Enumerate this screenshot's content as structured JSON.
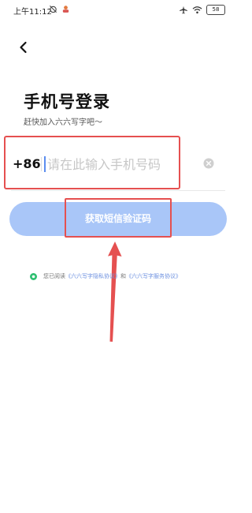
{
  "status_bar": {
    "time": "上午11:12",
    "battery": "58",
    "icons": [
      "alarm-off-icon",
      "app-notification-icon",
      "airplane-icon",
      "wifi-icon",
      "battery-icon"
    ]
  },
  "header": {
    "back_icon": "chevron-left-icon"
  },
  "login": {
    "title": "手机号登录",
    "subtitle": "赶快加入六六写字吧～",
    "country_code": "+86",
    "phone_placeholder": "请在此输入手机号码",
    "phone_value": "",
    "clear_icon": "clear-circle-icon",
    "get_code_label": "获取短信验证码"
  },
  "agreement": {
    "prefix": "您已阅读",
    "privacy_link": "《六六写字隐私协议》",
    "connector": "和",
    "service_link": "《六六写字服务协议》"
  },
  "colors": {
    "button_bg": "#a9c6f8",
    "annotation_red": "#e55050",
    "link_blue": "#6f92e0",
    "check_green": "#2fbf71"
  }
}
